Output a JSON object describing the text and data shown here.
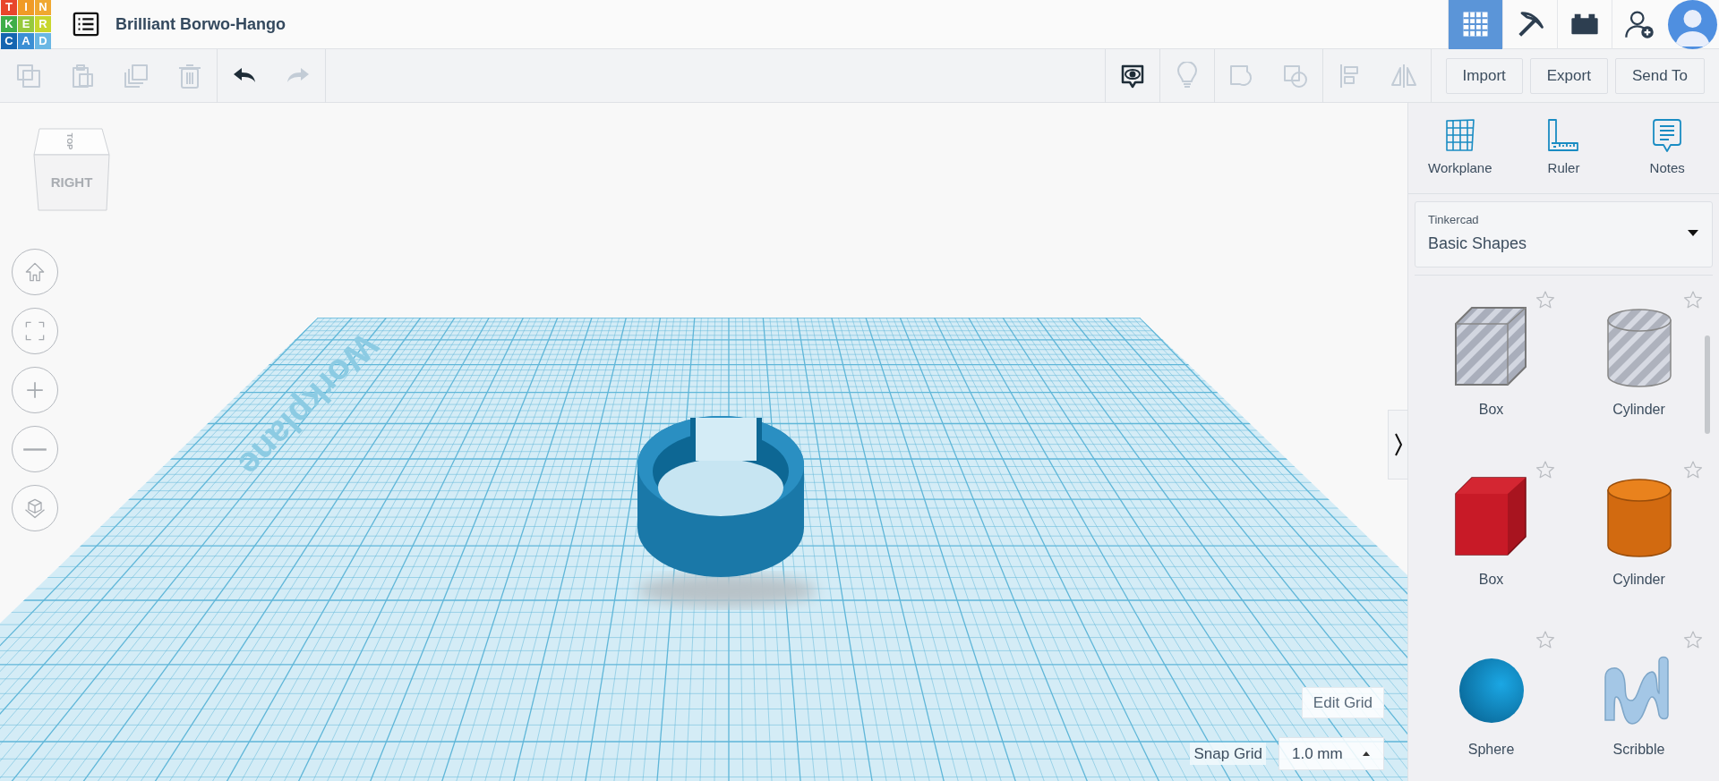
{
  "logo": {
    "letters": [
      {
        "char": "T",
        "color": "#e8452c"
      },
      {
        "char": "I",
        "color": "#f09b26"
      },
      {
        "char": "N",
        "color": "#f0a830"
      },
      {
        "char": "K",
        "color": "#3fae49"
      },
      {
        "char": "E",
        "color": "#97c93c"
      },
      {
        "char": "R",
        "color": "#c8d62d"
      },
      {
        "char": "C",
        "color": "#1565b0"
      },
      {
        "char": "A",
        "color": "#3b8fd4"
      },
      {
        "char": "D",
        "color": "#6ab7e4"
      }
    ]
  },
  "design": {
    "title": "Brilliant Borwo-Hango"
  },
  "view_modes": [
    {
      "kind": "grid",
      "selected": true
    },
    {
      "kind": "pickaxe",
      "selected": false
    },
    {
      "kind": "brick",
      "selected": false
    }
  ],
  "toolbar": {
    "edit_tools": [
      {
        "kind": "copy",
        "disabled": true
      },
      {
        "kind": "paste",
        "disabled": true
      },
      {
        "kind": "duplicate",
        "disabled": true
      },
      {
        "kind": "delete",
        "disabled": true
      }
    ],
    "history": [
      {
        "kind": "undo",
        "disabled": false
      },
      {
        "kind": "redo",
        "disabled": true
      }
    ],
    "view_tools": [
      {
        "kind": "notes-toggle",
        "disabled": false
      },
      {
        "kind": "bulb",
        "disabled": true
      },
      {
        "kind": "group",
        "disabled": true
      },
      {
        "kind": "ungroup",
        "disabled": true
      },
      {
        "kind": "align",
        "disabled": true
      },
      {
        "kind": "mirror",
        "disabled": true
      }
    ],
    "buttons": [
      "Import",
      "Export",
      "Send To"
    ]
  },
  "view_cube": {
    "front": "RIGHT",
    "top": "TOP"
  },
  "nav_buttons": [
    {
      "kind": "home"
    },
    {
      "kind": "fit"
    },
    {
      "kind": "zoom-in"
    },
    {
      "kind": "zoom-out"
    },
    {
      "kind": "ortho"
    }
  ],
  "workplane": {
    "label": "Workplane"
  },
  "edit_grid": "Edit Grid",
  "snap_grid": {
    "label": "Snap Grid",
    "value": "1.0 mm"
  },
  "panel": {
    "tools": [
      {
        "kind": "workplane",
        "label": "Workplane"
      },
      {
        "kind": "ruler",
        "label": "Ruler"
      },
      {
        "kind": "notes",
        "label": "Notes"
      }
    ],
    "library": {
      "source": "Tinkercad",
      "name": "Basic Shapes"
    },
    "shapes": [
      {
        "kind": "box-hole",
        "label": "Box",
        "favorite": false
      },
      {
        "kind": "cylinder-hole",
        "label": "Cylinder",
        "favorite": false
      },
      {
        "kind": "box",
        "label": "Box",
        "favorite": false
      },
      {
        "kind": "cylinder",
        "label": "Cylinder",
        "favorite": false
      },
      {
        "kind": "sphere",
        "label": "Sphere",
        "favorite": false
      },
      {
        "kind": "scribble",
        "label": "Scribble",
        "favorite": false
      }
    ]
  }
}
